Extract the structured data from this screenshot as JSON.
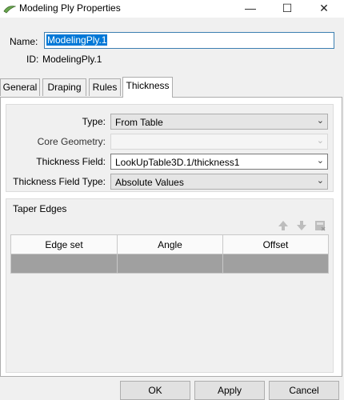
{
  "window": {
    "title": "Modeling Ply Properties",
    "icon": "ply-app-icon",
    "controls": {
      "minimize": "—",
      "maximize": "☐",
      "close": "✕"
    }
  },
  "header": {
    "name_label": "Name:",
    "name_value": "ModelingPly.1",
    "id_label": "ID:",
    "id_value": "ModelingPly.1"
  },
  "tabs": [
    {
      "label": "General",
      "active": false
    },
    {
      "label": "Draping",
      "active": false
    },
    {
      "label": "Rules",
      "active": false
    },
    {
      "label": "Thickness",
      "active": true
    }
  ],
  "thickness": {
    "type_label": "Type:",
    "type_value": "From Table",
    "core_geometry_label": "Core Geometry:",
    "core_geometry_value": "",
    "thickness_field_label": "Thickness Field:",
    "thickness_field_value": "LookUpTable3D.1/thickness1",
    "thickness_field_type_label": "Thickness Field Type:",
    "thickness_field_type_value": "Absolute Values"
  },
  "taper_edges": {
    "title": "Taper Edges",
    "columns": [
      "Edge set",
      "Angle",
      "Offset"
    ],
    "rows": [
      [
        "",
        "",
        ""
      ]
    ]
  },
  "buttons": {
    "ok": "OK",
    "apply": "Apply",
    "cancel": "Cancel"
  },
  "colors": {
    "selection": "#0078d7",
    "selected_row": "#a0a0a0",
    "icon_green": "#6aa84f"
  }
}
